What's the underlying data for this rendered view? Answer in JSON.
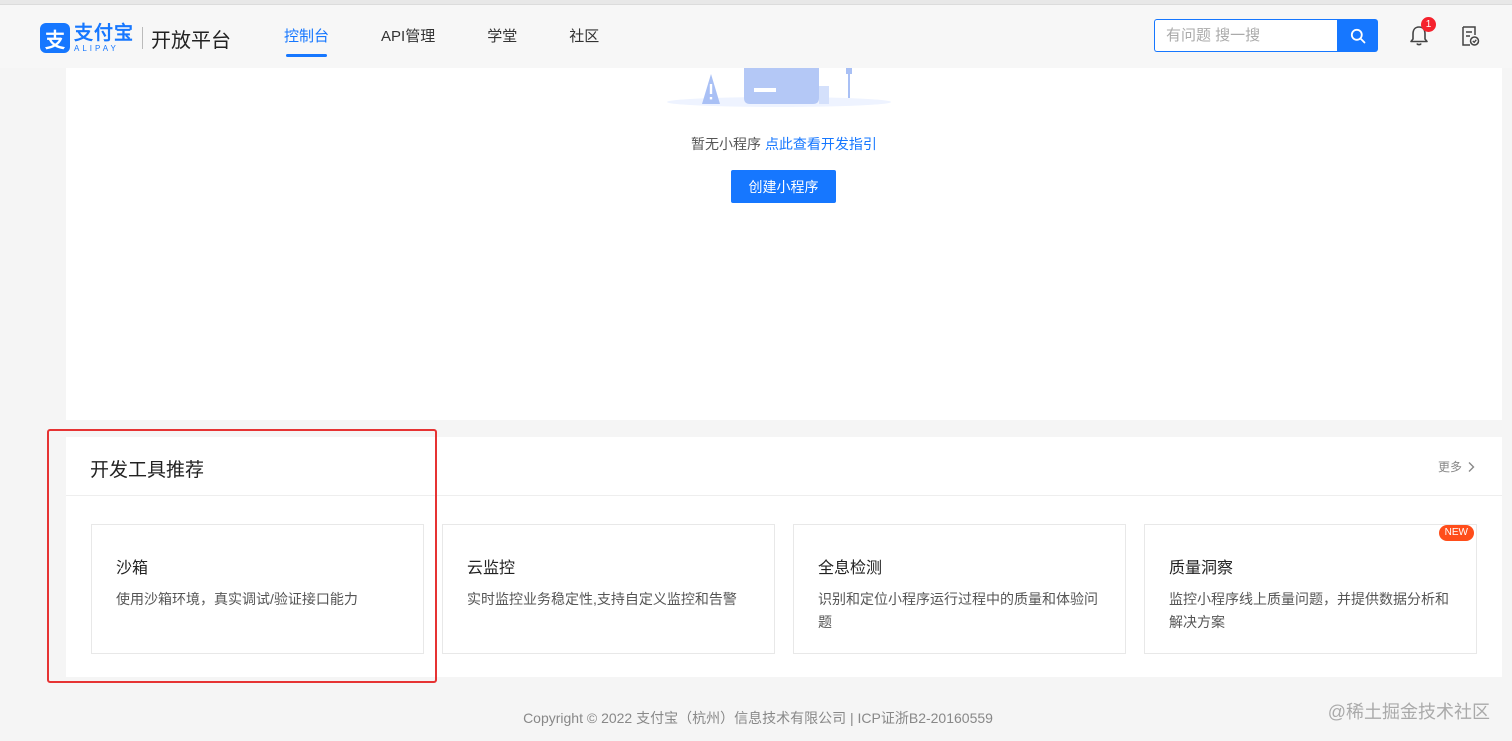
{
  "header": {
    "logo_cn": "支付宝",
    "logo_en": "ALIPAY",
    "logo_mark": "支",
    "product": "开放平台",
    "nav": [
      {
        "label": "控制台",
        "active": true
      },
      {
        "label": "API管理",
        "active": false
      },
      {
        "label": "学堂",
        "active": false
      },
      {
        "label": "社区",
        "active": false
      }
    ],
    "search_placeholder": "有问题 搜一搜",
    "notification_count": "1",
    "icons": {
      "search": "search-icon",
      "bell": "bell-icon",
      "doc": "document-check-icon"
    }
  },
  "empty_state": {
    "text": "暂无小程序",
    "link": "点此查看开发指引",
    "button": "创建小程序"
  },
  "tools": {
    "title": "开发工具推荐",
    "more": "更多",
    "cards": [
      {
        "title": "沙箱",
        "desc": "使用沙箱环境，真实调试/验证接口能力",
        "tag": ""
      },
      {
        "title": "云监控",
        "desc": "实时监控业务稳定性,支持自定义监控和告警",
        "tag": ""
      },
      {
        "title": "全息检测",
        "desc": "识别和定位小程序运行过程中的质量和体验问题",
        "tag": ""
      },
      {
        "title": "质量洞察",
        "desc": "监控小程序线上质量问题，并提供数据分析和解决方案",
        "tag": "NEW"
      }
    ]
  },
  "footer": "Copyright © 2022 支付宝（杭州）信息技术有限公司 | ICP证浙B2-20160559",
  "watermark": "@稀土掘金技术社区",
  "colors": {
    "accent": "#1677ff",
    "highlight": "#e63333",
    "badge": "#f5222d",
    "new_tag": "#ff4d1a"
  }
}
